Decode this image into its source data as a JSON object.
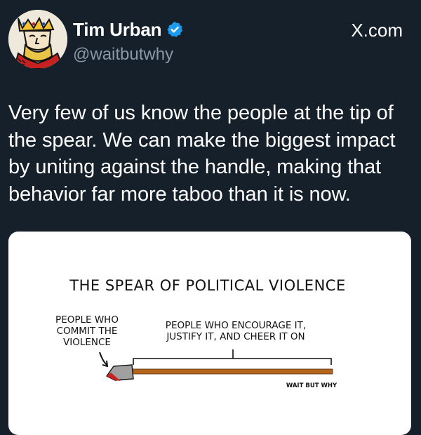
{
  "author": {
    "display_name": "Tim Urban",
    "handle": "@waitbutwhy",
    "verified": true
  },
  "site_label": "X.com",
  "tweet_text": "Very few of us know the people at the tip of the spear. We can make the biggest impact by uniting against the handle, making that behavior far more taboo than it is now.",
  "image": {
    "title": "THE SPEAR OF POLITICAL VIOLENCE",
    "tip_label": [
      "PEOPLE WHO",
      "COMMIT THE",
      "VIOLENCE"
    ],
    "handle_label": [
      "PEOPLE WHO ENCOURAGE IT,",
      "JUSTIFY IT, AND CHEER IT ON"
    ],
    "watermark": "WAIT BUT WHY"
  },
  "colors": {
    "background": "#15202b",
    "verified_badge": "#1d9bf0",
    "secondary_text": "#8b98a5",
    "spear_handle": "#b5651d",
    "spear_tip": "#9a9a9a",
    "blood": "#cc1f1f"
  },
  "icons": {
    "avatar": "king-playing-card-avatar",
    "verified": "verified-badge-icon"
  }
}
